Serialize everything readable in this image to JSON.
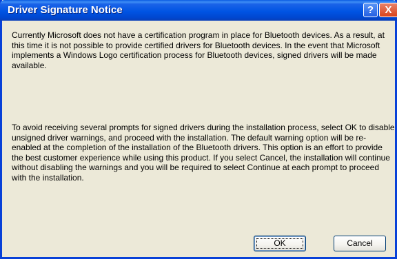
{
  "dialog": {
    "title": "Driver Signature Notice",
    "help_glyph": "?",
    "close_glyph": "X",
    "paragraph1": "Currently Microsoft does not have a certification program in place for Bluetooth devices. As a result, at this time it is not possible to provide certified drivers for Bluetooth devices.  In the event that Microsoft implements a Windows Logo certification process for Bluetooth devices, signed drivers will be made available.",
    "paragraph2": "To avoid receiving several prompts for signed drivers during the installation process, select OK to disable unsigned driver warnings, and proceed with the installation. The default warning option will be re-enabled at the completion of the installation of the Bluetooth drivers. This option is an effort to provide the best customer experience while using this product. If you select Cancel, the installation will continue without disabling the warnings and you will be required to select Continue at each prompt to proceed with the installation.",
    "ok_label": "OK",
    "cancel_label": "Cancel"
  }
}
